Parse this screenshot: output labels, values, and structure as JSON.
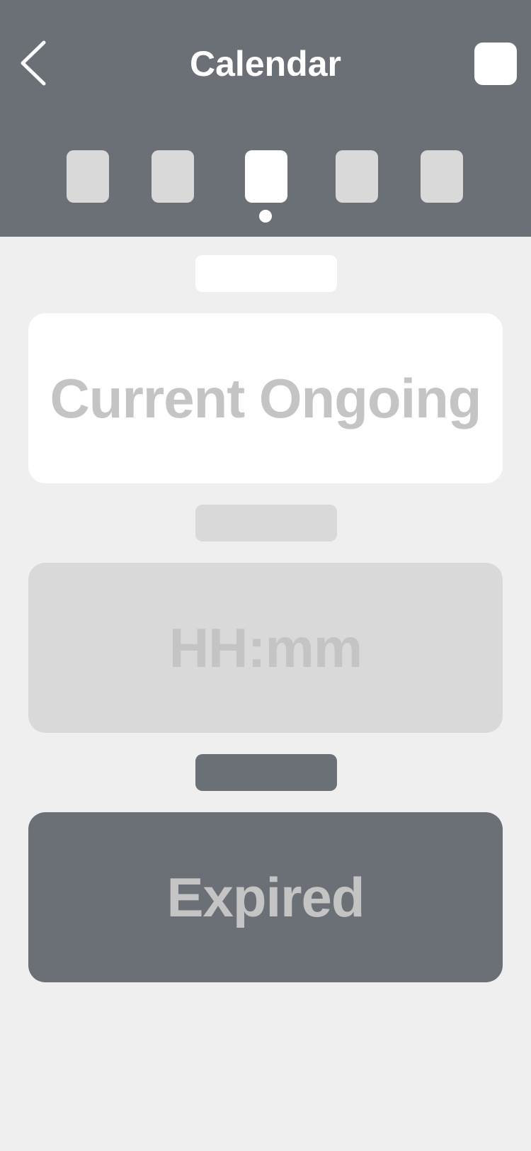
{
  "header": {
    "title": "Calendar",
    "back_icon": "chevron-left-icon"
  },
  "day_selector": {
    "count": 5,
    "selected_index": 2
  },
  "sections": [
    {
      "pill_color": "#ffffff",
      "card_color": "#ffffff",
      "card_text": "Current Ongoing",
      "text_color": "#c4c4c4"
    },
    {
      "pill_color": "#d9d9d9",
      "card_color": "#d9d9d9",
      "card_text": "HH:mm",
      "text_color": "#c4c4c4"
    },
    {
      "pill_color": "#6b7077",
      "card_color": "#6b7077",
      "card_text": "Expired",
      "text_color": "#c4c4c4"
    }
  ],
  "colors": {
    "header_bg": "#6b7077",
    "page_bg": "#efefef",
    "placeholder_light": "#d9d9d9",
    "white": "#ffffff"
  }
}
